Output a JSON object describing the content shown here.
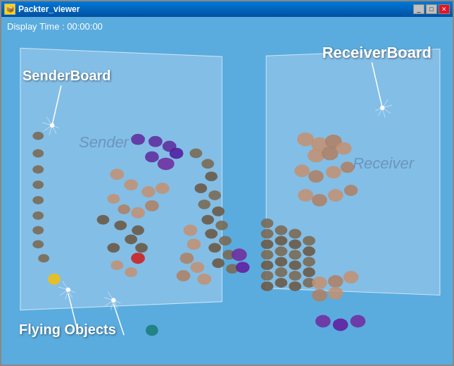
{
  "window": {
    "title": "Packter_viewer",
    "title_icon": "📦"
  },
  "title_controls": {
    "minimize": "_",
    "restore": "□",
    "close": "✕"
  },
  "canvas": {
    "display_time_label": "Display Time : 00:00:00",
    "sender_board_label": "SenderBoard",
    "receiver_board_label": "ReceiverBoard",
    "sender_watermark": "Sender",
    "receiver_watermark": "Receiver",
    "flying_objects_label": "Flying Objects"
  },
  "colors": {
    "background": "#5aacdf",
    "board_bg": "rgba(180,210,240,0.45)",
    "purple": "#7030a0",
    "tan": "#c4956a",
    "dark_tan": "#8b7355",
    "yellow": "#ffd700",
    "teal": "#008080",
    "red": "#cc2222",
    "dark": "#4a4040"
  }
}
